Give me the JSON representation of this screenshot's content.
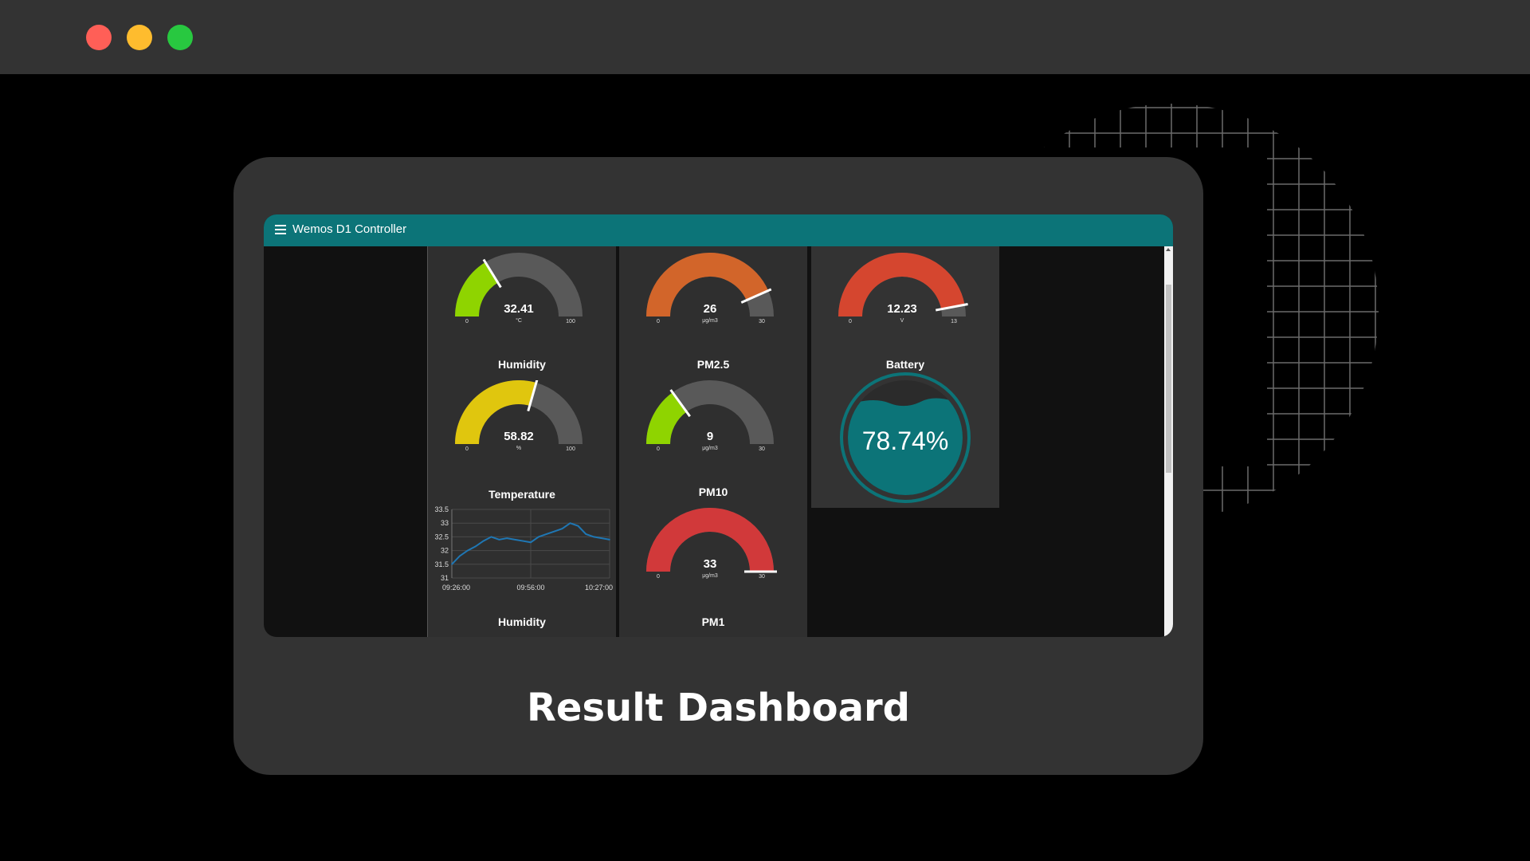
{
  "window": {
    "controls": [
      "close",
      "minimize",
      "maximize"
    ]
  },
  "app": {
    "title": "Wemos D1 Controller"
  },
  "gauges": {
    "temperature": {
      "value": "32.41",
      "unit": "°C",
      "min": "0",
      "max": "100",
      "fraction": 0.3241,
      "color": "#8fd400"
    },
    "humidity": {
      "title": "Humidity",
      "value": "58.82",
      "unit": "%",
      "min": "0",
      "max": "100",
      "fraction": 0.5882,
      "color": "#e0c60e"
    },
    "pm25_top": {
      "value": "26",
      "unit": "μg/m3",
      "min": "0",
      "max": "30",
      "fraction": 0.8667,
      "color": "#d2652a"
    },
    "pm25": {
      "title": "PM2.5",
      "value": "9",
      "unit": "μg/m3",
      "min": "0",
      "max": "30",
      "fraction": 0.3,
      "color": "#8fd400"
    },
    "pm10": {
      "title": "PM10",
      "value": "33",
      "unit": "μg/m3",
      "min": "0",
      "max": "30",
      "fraction": 1.0,
      "color": "#d1393a"
    },
    "voltage": {
      "value": "12.23",
      "unit": "V",
      "min": "0",
      "max": "13",
      "fraction": 0.9408,
      "color": "#d5462f"
    }
  },
  "battery": {
    "title": "Battery",
    "value": "78.74%",
    "fraction": 0.7874,
    "color": "#0c7478"
  },
  "temperature_chart": {
    "title": "Temperature",
    "y_ticks": [
      "33.5",
      "33",
      "32.5",
      "32",
      "31.5",
      "31"
    ],
    "x_ticks": [
      "09:26:00",
      "09:56:00",
      "10:27:00"
    ]
  },
  "labels": {
    "humidity_bottom": "Humidity",
    "pm1": "PM1"
  },
  "footer": {
    "title": "Result Dashboard"
  },
  "chart_data": {
    "type": "line",
    "title": "Temperature",
    "xlabel": "",
    "ylabel": "",
    "x": [
      "09:26:00",
      "09:29:00",
      "09:32:00",
      "09:35:00",
      "09:38:00",
      "09:41:00",
      "09:44:00",
      "09:47:00",
      "09:50:00",
      "09:53:00",
      "09:56:00",
      "09:59:00",
      "10:02:00",
      "10:05:00",
      "10:08:00",
      "10:11:00",
      "10:14:00",
      "10:17:00",
      "10:20:00",
      "10:23:00",
      "10:26:00"
    ],
    "values": [
      31.5,
      31.8,
      32.0,
      32.15,
      32.35,
      32.5,
      32.4,
      32.45,
      32.4,
      32.35,
      32.3,
      32.5,
      32.6,
      32.7,
      32.8,
      33.0,
      32.9,
      32.6,
      32.5,
      32.45,
      32.4
    ],
    "ylim": [
      31,
      33.5
    ],
    "grid": true,
    "color": "#1f77b4"
  }
}
